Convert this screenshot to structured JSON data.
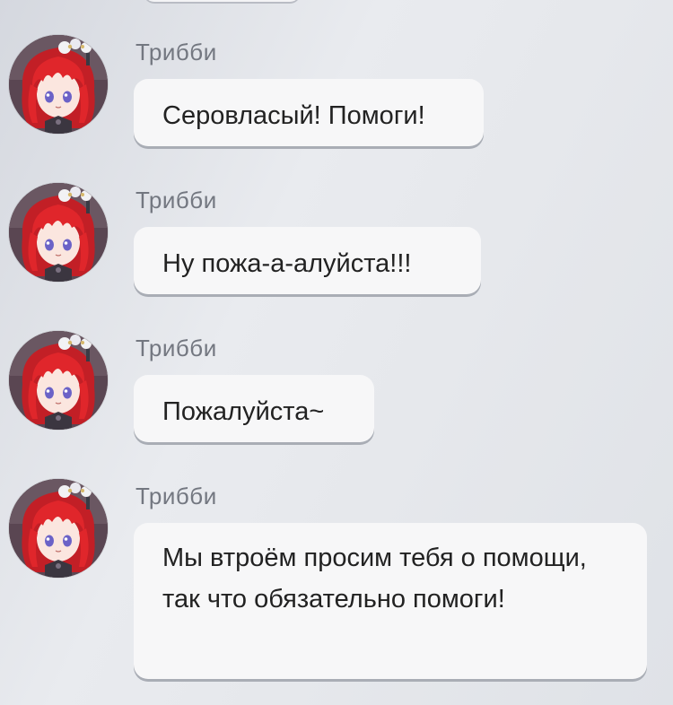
{
  "messages": [
    {
      "sender": "Трибби",
      "text": "Серовласый! Помоги!"
    },
    {
      "sender": "Трибби",
      "text": "Ну пожа-а-алуйста!!!"
    },
    {
      "sender": "Трибби",
      "text": "Пожалуйста~"
    },
    {
      "sender": "Трибби",
      "text": "Мы втроём просим тебя о помощи, так что обязательно помоги!"
    }
  ],
  "avatar_icon": "red-haired-girl-avatar-icon",
  "colors": {
    "bubble": "#f7f7f8",
    "sender_text": "#737780",
    "message_text": "#222222",
    "hair": "#d8262b"
  }
}
